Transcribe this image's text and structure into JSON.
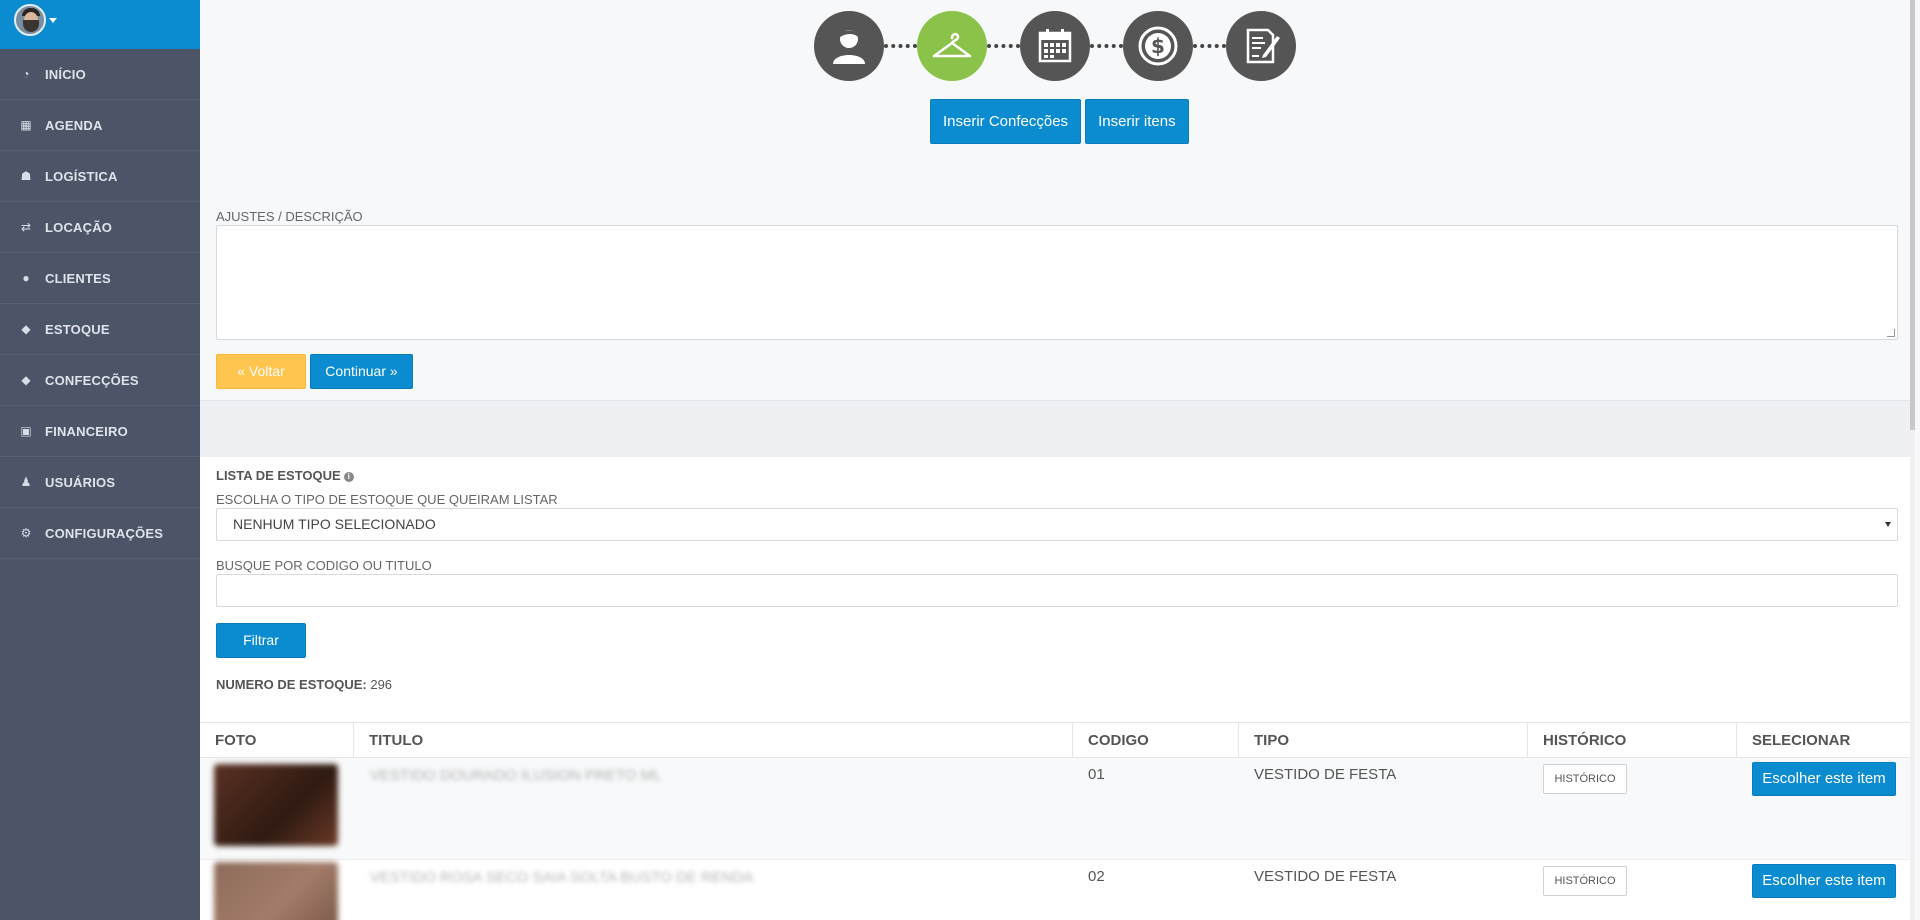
{
  "sidebar": {
    "items": [
      {
        "label": "INÍCIO",
        "icon": "dashboard-icon"
      },
      {
        "label": "AGENDA",
        "icon": "calendar-icon"
      },
      {
        "label": "LOGÍSTICA",
        "icon": "sitemap-icon"
      },
      {
        "label": "LOCAÇÃO",
        "icon": "exchange-icon"
      },
      {
        "label": "CLIENTES",
        "icon": "users-icon"
      },
      {
        "label": "ESTOQUE",
        "icon": "tag-icon"
      },
      {
        "label": "CONFECÇÕES",
        "icon": "tag-icon"
      },
      {
        "label": "FINANCEIRO",
        "icon": "money-icon"
      },
      {
        "label": "USUÁRIOS",
        "icon": "user-icon"
      },
      {
        "label": "CONFIGURAÇÕES",
        "icon": "cogs-icon"
      }
    ]
  },
  "wizard": {
    "steps": [
      "user-icon",
      "hanger-icon",
      "calendar-icon",
      "dollar-icon",
      "contract-icon"
    ],
    "active_step": 1,
    "buttons": {
      "insert_confeccoes": "Inserir Confecções",
      "insert_items": "Inserir itens"
    }
  },
  "form": {
    "ajustes_label": "AJUSTES / DESCRIÇÃO",
    "back_label": "« Voltar",
    "continue_label": "Continuar »"
  },
  "stock": {
    "title": "LISTA DE ESTOQUE",
    "select_label": "ESCOLHA O TIPO DE ESTOQUE QUE QUEIRAM LISTAR",
    "select_value": "NENHUM TIPO SELECIONADO",
    "search_label": "BUSQUE POR CODIGO OU TITULO",
    "filter_label": "Filtrar",
    "count_label": "NUMERO DE ESTOQUE:",
    "count_value": "296"
  },
  "table": {
    "headers": [
      "FOTO",
      "TITULO",
      "CODIGO",
      "TIPO",
      "HISTÓRICO",
      "SELECIONAR"
    ],
    "rows": [
      {
        "titulo": "VESTIDO DOURADO ILUSION PRETO ML",
        "codigo": "01",
        "tipo": "VESTIDO DE FESTA",
        "historico": "HISTÓRICO",
        "selecionar": "Escolher este item"
      },
      {
        "titulo": "VESTIDO ROSA SECO SAIA SOLTA BUSTO DE RENDA",
        "codigo": "02",
        "tipo": "VESTIDO DE FESTA",
        "historico": "HISTÓRICO",
        "selecionar": "Escolher este item"
      }
    ]
  },
  "colors": {
    "primary": "#0b8cd0",
    "warning": "#ffc54f",
    "sidebar": "#4c5568",
    "active_step": "#8bc34a",
    "step": "#555555"
  }
}
